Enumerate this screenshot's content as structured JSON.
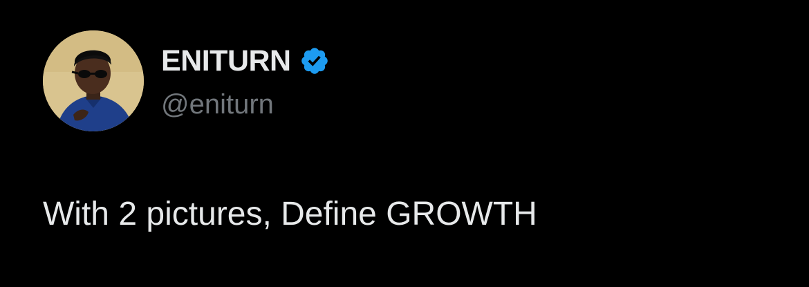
{
  "author": {
    "display_name": "ENITURN",
    "handle": "@eniturn",
    "verified_icon": "verified-badge-icon",
    "avatar_icon": "avatar-photo"
  },
  "tweet": {
    "text": "With 2 pictures, Define GROWTH"
  },
  "colors": {
    "background": "#000000",
    "primary_text": "#e7e9ea",
    "secondary_text": "#71767b",
    "verified_blue": "#1d9bf0"
  }
}
